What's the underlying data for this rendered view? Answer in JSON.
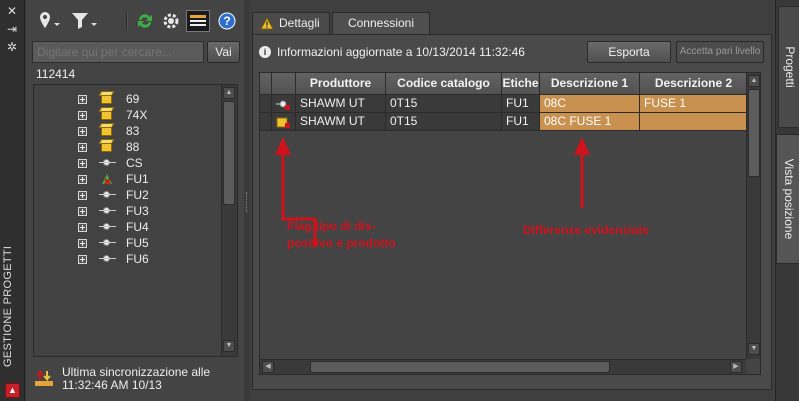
{
  "left_strip": {
    "close_glyph": "✕",
    "pin_glyph": "⇥",
    "settings_glyph": "✲",
    "title": "GESTIONE PROGETTI",
    "red_button_glyph": "▲"
  },
  "left_panel": {
    "search": {
      "placeholder": "Digitare qui per cercare...",
      "button": "Vai"
    },
    "current_code": "112414",
    "tree_items": [
      {
        "label": "69",
        "icon": "box-icon"
      },
      {
        "label": "74X",
        "icon": "box-icon"
      },
      {
        "label": "83",
        "icon": "box-icon"
      },
      {
        "label": "88",
        "icon": "box-icon"
      },
      {
        "label": "CS",
        "icon": "device-icon"
      },
      {
        "label": "FU1",
        "icon": "device-warning-icon"
      },
      {
        "label": "FU2",
        "icon": "device-icon"
      },
      {
        "label": "FU3",
        "icon": "device-icon"
      },
      {
        "label": "FU4",
        "icon": "device-icon"
      },
      {
        "label": "FU5",
        "icon": "device-icon"
      },
      {
        "label": "FU6",
        "icon": "device-icon"
      }
    ],
    "sync": {
      "line1": "Ultima sincronizzazione alle",
      "line2": "11:32:46 AM 10/13"
    }
  },
  "main": {
    "tabs": [
      {
        "label": "Dettagli",
        "icon": "warning-icon"
      },
      {
        "label": "Connessioni"
      }
    ],
    "info_text": "Informazioni aggiornate a 10/13/2014 11:32:46",
    "export_button": "Esporta",
    "accept_button": "Accetta pari livello",
    "columns": [
      "Produttore",
      "Codice catalogo",
      "Etiche",
      "Descrizione 1",
      "Descrizione 2"
    ],
    "rows": [
      {
        "icon": "device-flag-icon",
        "produttore": "SHAWM UT",
        "codice": "0T15",
        "etichetta": "FU1",
        "desc1": "08C",
        "desc2": "FUSE 1"
      },
      {
        "icon": "product-flag-icon",
        "produttore": "SHAWM UT",
        "codice": "0T15",
        "etichetta": "FU1",
        "desc1": "08C FUSE 1",
        "desc2": ""
      }
    ],
    "highlight_color": "#c8914f"
  },
  "annotations": {
    "flag_label": "Flag tipo di dis- positivo e prodotto",
    "diff_label": "Differenze evidenziate",
    "color": "#d0121d"
  },
  "side_tabs": [
    {
      "label": "Progetti",
      "active": false
    },
    {
      "label": "Vista posizione",
      "active": true
    }
  ]
}
